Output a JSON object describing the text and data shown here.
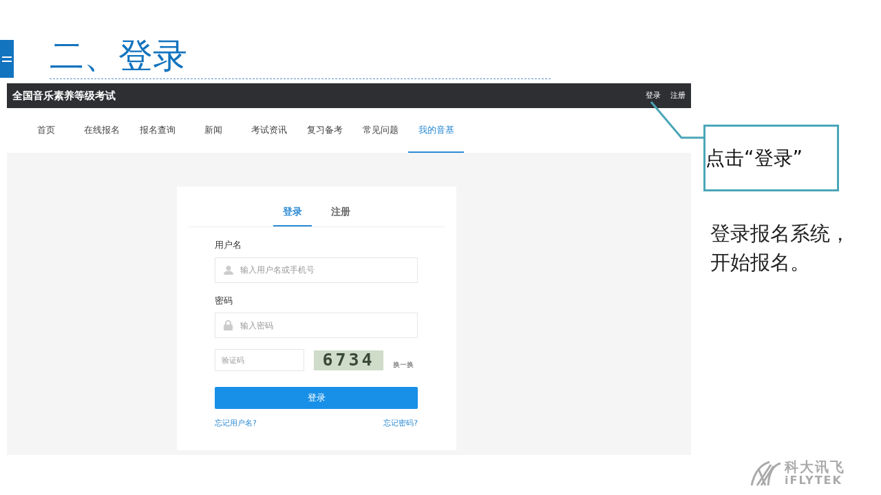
{
  "slide": {
    "title": "二、登录"
  },
  "site": {
    "name": "全国音乐素养等级考试",
    "top_links": [
      {
        "label": "登录"
      },
      {
        "label": "注册"
      }
    ],
    "nav": [
      {
        "label": "首页",
        "selected": false
      },
      {
        "label": "在线报名",
        "selected": false
      },
      {
        "label": "报名查询",
        "selected": false
      },
      {
        "label": "新闻",
        "selected": false
      },
      {
        "label": "考试资讯",
        "selected": false
      },
      {
        "label": "复习备考",
        "selected": false
      },
      {
        "label": "常见问题",
        "selected": false
      },
      {
        "label": "我的音基",
        "selected": true
      }
    ],
    "login": {
      "tabs": [
        {
          "label": "登录",
          "selected": true
        },
        {
          "label": "注册",
          "selected": false
        }
      ],
      "username_label": "用户名",
      "username_placeholder": "输入用户名或手机号",
      "password_label": "密码",
      "password_placeholder": "输入密码",
      "captcha_placeholder": "验证码",
      "captcha_code": "6734",
      "refresh": "换一换",
      "submit": "登录",
      "forgot_username": "忘记用户名?",
      "forgot_password": "忘记密码?"
    }
  },
  "callout": {
    "text": "点击“登录”"
  },
  "note": "登录报名系统，开始报名。",
  "logo": {
    "name": "科大讯飞",
    "latin": "iFLYTEK"
  }
}
